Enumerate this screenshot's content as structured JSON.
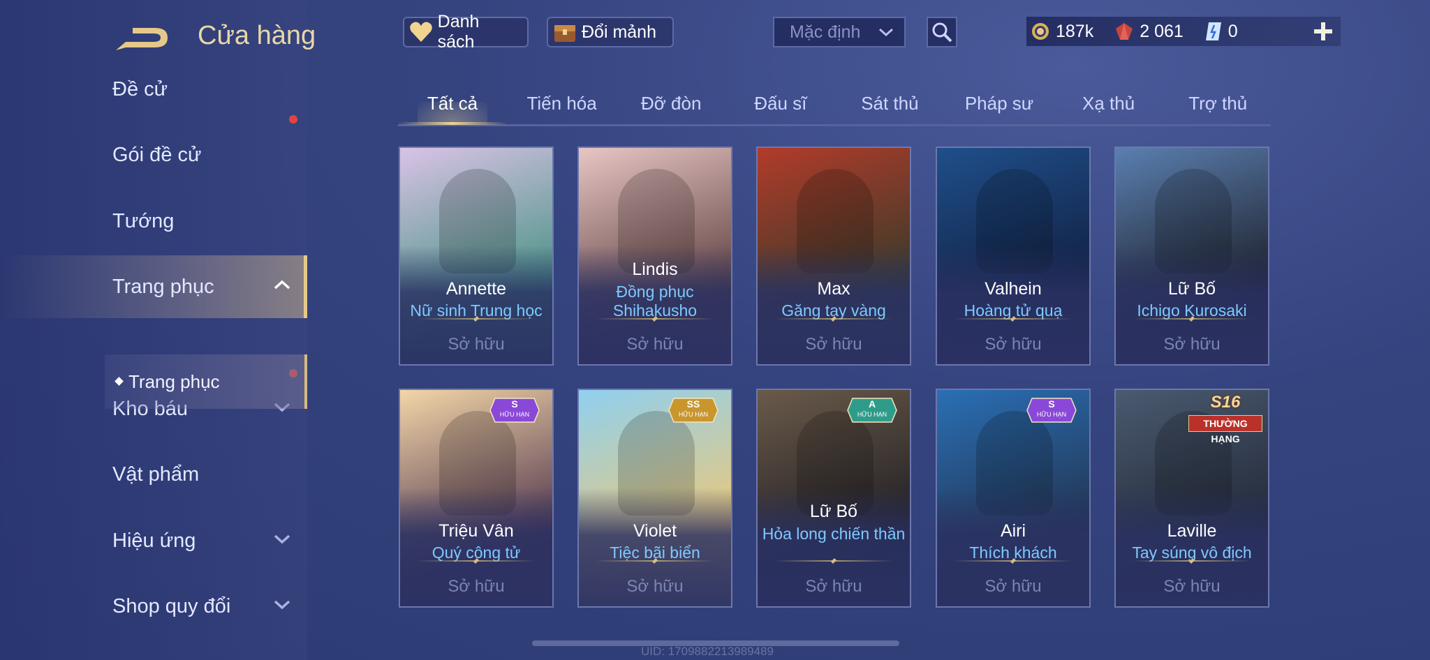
{
  "header": {
    "title": "Cửa hàng",
    "wishlist_label": "Danh sách",
    "exchange_label": "Đổi mảnh",
    "sort_value": "Mặc định"
  },
  "currency": {
    "gold": "187k",
    "vouchers": "2 061",
    "tokens": "0"
  },
  "sidebar": {
    "items": [
      {
        "label": "Đề cử",
        "dot": false,
        "chevron": "none"
      },
      {
        "label": "Gói đề cử",
        "dot": true,
        "chevron": "none"
      },
      {
        "label": "Tướng",
        "dot": false,
        "chevron": "none"
      },
      {
        "label": "Trang phục",
        "dot": false,
        "chevron": "up",
        "active": true
      },
      {
        "label": "Kho báu",
        "dot": true,
        "chevron": "down"
      },
      {
        "label": "Vật phẩm",
        "dot": false,
        "chevron": "none"
      },
      {
        "label": "Hiệu ứng",
        "dot": false,
        "chevron": "down"
      },
      {
        "label": "Shop quy đổi",
        "dot": false,
        "chevron": "down"
      }
    ],
    "sub_item": "Trang phục"
  },
  "tabs": [
    "Tất cả",
    "Tiến hóa",
    "Đỡ đòn",
    "Đấu sĩ",
    "Sát thủ",
    "Pháp sư",
    "Xạ thủ",
    "Trợ thủ"
  ],
  "active_tab": 0,
  "cards": [
    {
      "hero": "Annette",
      "skin": "Nữ sinh Trung học",
      "status": "Sở hữu",
      "bg": [
        "#d9c3e6",
        "#3f8f7e"
      ],
      "badge": null
    },
    {
      "hero": "Lindis",
      "skin": "Đồng phục Shihakusho",
      "status": "Sở hữu",
      "bg": [
        "#e7c6c4",
        "#5a3b3b"
      ],
      "badge": null
    },
    {
      "hero": "Max",
      "skin": "Găng tay vàng",
      "status": "Sở hữu",
      "bg": [
        "#b23b2a",
        "#2d3b2a"
      ],
      "badge": null
    },
    {
      "hero": "Valhein",
      "skin": "Hoàng tử quạ",
      "status": "Sở hữu",
      "bg": [
        "#1f4f8a",
        "#101c3c"
      ],
      "badge": null
    },
    {
      "hero": "Lữ Bố",
      "skin": "Ichigo Kurosaki",
      "status": "Sở hữu",
      "bg": [
        "#5a7fb0",
        "#1a1a22"
      ],
      "badge": null
    },
    {
      "hero": "Triệu Vân",
      "skin": "Quý công tử",
      "status": "Sở hữu",
      "bg": [
        "#f3d6a8",
        "#4a2f4a"
      ],
      "badge": {
        "rank": "S",
        "text": "HỮU HẠN",
        "color": "#8a48d8"
      }
    },
    {
      "hero": "Violet",
      "skin": "Tiệc bãi biển",
      "status": "Sở hữu",
      "bg": [
        "#8fd0f0",
        "#f2c870"
      ],
      "badge": {
        "rank": "SS",
        "text": "HỮU HẠN",
        "color": "#c9962e"
      }
    },
    {
      "hero": "Lữ Bố",
      "skin": "Hỏa long chiến thần",
      "status": "Sở hữu",
      "bg": [
        "#6a5a4a",
        "#1c1b22"
      ],
      "badge": {
        "rank": "A",
        "text": "HỮU HẠN",
        "color": "#2f9c8a"
      }
    },
    {
      "hero": "Airi",
      "skin": "Thích khách",
      "status": "Sở hữu",
      "bg": [
        "#2a6fb5",
        "#22304a"
      ],
      "badge": {
        "rank": "S",
        "text": "HỮU HẠN",
        "color": "#8a48d8"
      }
    },
    {
      "hero": "Laville",
      "skin": "Tay súng vô địch",
      "status": "Sở hữu",
      "bg": [
        "#4a5a70",
        "#202534"
      ],
      "season": {
        "code": "S16",
        "text": "THƯỜNG HẠNG"
      }
    }
  ],
  "uid_text": "UID: 1709882213989489",
  "colors": {
    "accent_gold": "#e6c98a",
    "skin_blue": "#7ec9ff",
    "owned_gray": "#7c86b2"
  }
}
